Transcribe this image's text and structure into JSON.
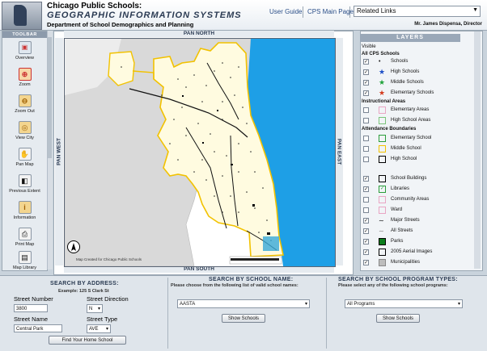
{
  "header": {
    "title_line1": "Chicago Public Schools:",
    "title_line2": "GEOGRAPHIC INFORMATION SYSTEMS",
    "title_line3": "Department of School Demographics and Planning",
    "links": {
      "user_guide": "User Guide",
      "cps_main": "CPS Main Page"
    },
    "related_links_value": "Related Links",
    "director": "Mr. James Dispensa, Director"
  },
  "toolbar": {
    "title": "TOOLBAR",
    "tools": [
      {
        "label": "Overview",
        "icon": "overview-icon"
      },
      {
        "label": "Zoom",
        "icon": "zoom-in-icon"
      },
      {
        "label": "Zoom Out",
        "icon": "zoom-out-icon"
      },
      {
        "label": "View City",
        "icon": "view-city-icon"
      },
      {
        "label": "Pan Map",
        "icon": "hand-icon"
      },
      {
        "label": "Previous Extent",
        "icon": "previous-extent-icon"
      },
      {
        "label": "Information",
        "icon": "information-icon"
      },
      {
        "label": "Print Map",
        "icon": "printer-icon"
      },
      {
        "label": "Map Library",
        "icon": "map-library-icon"
      }
    ]
  },
  "map": {
    "pan_north": "PAN NORTH",
    "pan_south": "PAN SOUTH",
    "pan_west": "PAN WEST",
    "pan_east": "PAN EAST",
    "credit": "Map Created for Chicago Public Schools",
    "colors": {
      "lake": "#1e9fe6",
      "city_fill": "#fffbe0",
      "suburb": "#d9d9d9",
      "boundary": "#f2c200",
      "road": "#111111"
    }
  },
  "layers": {
    "title": "LAYERS",
    "visible_label": "Visible",
    "groups": [
      {
        "heading": "All CPS Schools",
        "items": [
          {
            "label": "Schools",
            "checked": true,
            "symbol": "dot"
          },
          {
            "label": "High Schools",
            "checked": true,
            "symbol": "blue-star"
          },
          {
            "label": "Middle Schools",
            "checked": true,
            "symbol": "green-star"
          },
          {
            "label": "Elementary Schools",
            "checked": true,
            "symbol": "red-star"
          }
        ]
      },
      {
        "heading": "Instructional Areas",
        "items": [
          {
            "label": "Elementary Areas",
            "checked": false,
            "symbol": "box-pink"
          },
          {
            "label": "High School Areas",
            "checked": false,
            "symbol": "box-green"
          }
        ]
      },
      {
        "heading": "Attendance Boundaries",
        "items": [
          {
            "label": "Elementary School",
            "checked": false,
            "symbol": "box-green"
          },
          {
            "label": "Middle School",
            "checked": false,
            "symbol": "box-yellow"
          },
          {
            "label": "High School",
            "checked": false,
            "symbol": "box-black"
          }
        ]
      },
      {
        "heading": "",
        "items": [
          {
            "label": "School Buildings",
            "checked": true,
            "symbol": "box-black"
          },
          {
            "label": "Libraries",
            "checked": true,
            "symbol": "box-check"
          },
          {
            "label": "Community Areas",
            "checked": false,
            "symbol": "box-pink"
          },
          {
            "label": "Ward",
            "checked": false,
            "symbol": "box-pink"
          },
          {
            "label": "Major Streets",
            "checked": true,
            "symbol": "line-black"
          },
          {
            "label": "All Streets",
            "checked": true,
            "symbol": "line-gray"
          },
          {
            "label": "Parks",
            "checked": true,
            "symbol": "box-darkgreen"
          },
          {
            "label": "2005 Aerial Images",
            "checked": true,
            "symbol": "box-black"
          },
          {
            "label": "Municipalities",
            "checked": true,
            "symbol": "box-gray"
          }
        ]
      }
    ]
  },
  "search_address": {
    "title": "SEARCH BY ADDRESS:",
    "example": "Example: 125 S Clark St",
    "street_number_label": "Street Number",
    "street_number_value": "3800",
    "street_direction_label": "Street Direction",
    "street_direction_value": "N",
    "street_name_label": "Street Name",
    "street_name_value": "Central Park",
    "street_type_label": "Street Type",
    "street_type_value": "AVE",
    "button": "Find Your Home School"
  },
  "search_name": {
    "title": "SEARCH BY SCHOOL NAME:",
    "subtitle": "Please choose from the following list of valid school names:",
    "selected": "AASTA",
    "button": "Show Schools"
  },
  "search_program": {
    "title": "SEARCH BY SCHOOL PROGRAM TYPES:",
    "subtitle": "Please select any of the following school programs:",
    "selected": "All Programs",
    "button": "Show Schools"
  }
}
